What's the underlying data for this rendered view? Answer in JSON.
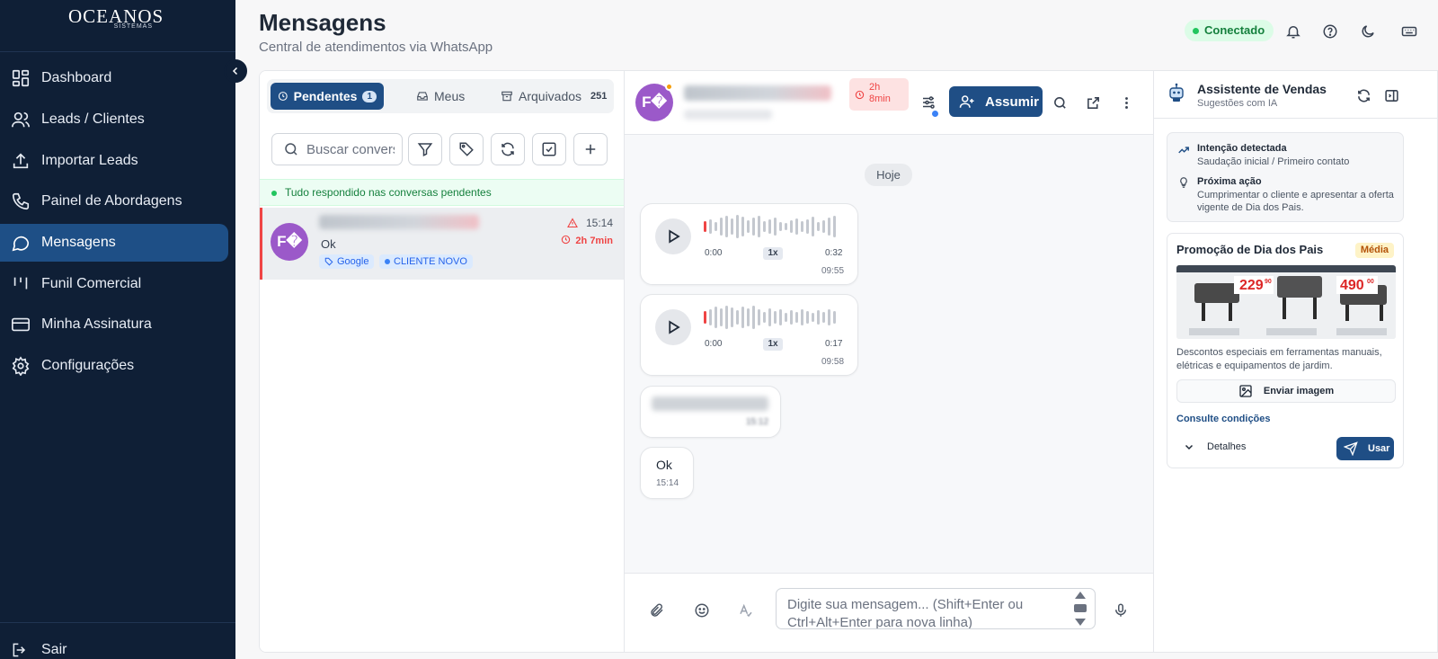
{
  "sidebar": {
    "logo_main": "OCEANOS",
    "logo_sub": "SISTEMAS",
    "items": [
      {
        "label": "Dashboard"
      },
      {
        "label": "Leads / Clientes"
      },
      {
        "label": "Importar Leads"
      },
      {
        "label": "Painel de Abordagens"
      },
      {
        "label": "Mensagens"
      },
      {
        "label": "Funil Comercial"
      },
      {
        "label": "Minha Assinatura"
      },
      {
        "label": "Configurações"
      }
    ],
    "active_item": "Mensagens",
    "logout_label": "Sair"
  },
  "header": {
    "title": "Mensagens",
    "subtitle": "Central de atendimentos via WhatsApp",
    "status": "Conectado"
  },
  "conversations": {
    "tabs": [
      {
        "label": "Pendentes",
        "count": "1"
      },
      {
        "label": "Meus"
      },
      {
        "label": "Arquivados",
        "count": "251"
      }
    ],
    "search_placeholder": "Buscar conversas",
    "notice": "Tudo respondido nas conversas pendentes",
    "items": [
      {
        "avatar": "F�",
        "last_message": "Ok",
        "time": "15:14",
        "wait": "2h 7min",
        "tags": [
          "Google",
          "CLIENTE NOVO"
        ]
      }
    ]
  },
  "chat": {
    "avatar": "F�",
    "wait_badge_line1": "2h",
    "wait_badge_line2": "8min",
    "assume_label": "Assumir",
    "day_label": "Hoje",
    "messages": [
      {
        "type": "audio",
        "start": "0:00",
        "speed": "1x",
        "duration": "0:32",
        "time": "09:55"
      },
      {
        "type": "audio",
        "start": "0:00",
        "speed": "1x",
        "duration": "0:17",
        "time": "09:58"
      },
      {
        "type": "text-blurred",
        "time": "15:12"
      },
      {
        "type": "text",
        "text": "Ok",
        "time": "15:14"
      }
    ],
    "composer_placeholder": "Digite sua mensagem... (Shift+Enter ou Ctrl+Alt+Enter para nova linha)"
  },
  "assistant": {
    "title": "Assistente de Vendas",
    "subtitle": "Sugestões com IA",
    "intent_title": "Intenção detectada",
    "intent_text": "Saudação inicial / Primeiro contato",
    "next_title": "Próxima ação",
    "next_text": "Cumprimentar o cliente e apresentar a oferta vigente de Dia dos Pais.",
    "promo": {
      "title": "Promoção de Dia dos Pais",
      "priority": "Média",
      "price1": "229",
      "price1_cents": "90",
      "price2": "490",
      "price2_cents": "00",
      "description": "Descontos especiais em ferramentas manuais, elétricas e equipamentos de jardim.",
      "send_image_label": "Enviar imagem",
      "conditions_label": "Consulte condições",
      "details_label": "Detalhes",
      "use_label": "Usar"
    }
  },
  "colors": {
    "sidebar_bg": "#0f1f36",
    "accent": "#1f4e85",
    "alert": "#ef4444",
    "success": "#22c55e",
    "avatar": "#9b59c9"
  }
}
